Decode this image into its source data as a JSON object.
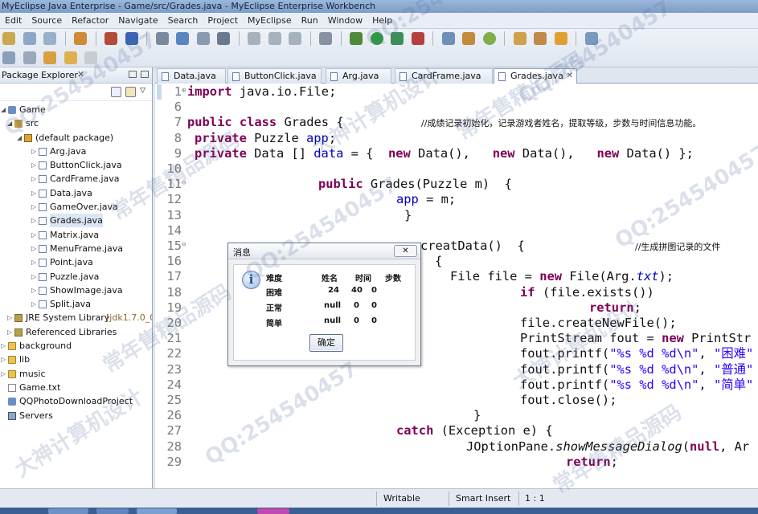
{
  "window": {
    "title": "MyEclipse Java Enterprise - Game/src/Grades.java - MyEclipse Enterprise Workbench"
  },
  "menu": [
    "Edit",
    "Source",
    "Refactor",
    "Navigate",
    "Search",
    "Project",
    "MyEclipse",
    "Run",
    "Window",
    "Help"
  ],
  "package_explorer": {
    "title": "Package Explorer",
    "close": "✕",
    "tree": [
      {
        "label": "Game",
        "icon": "project-icon"
      },
      {
        "label": "src",
        "icon": "source-folder-icon"
      },
      {
        "label": "(default package)",
        "icon": "package-icon"
      },
      {
        "label": "Arg.java",
        "icon": "java-file-icon"
      },
      {
        "label": "ButtonClick.java",
        "icon": "java-file-icon"
      },
      {
        "label": "CardFrame.java",
        "icon": "java-file-icon"
      },
      {
        "label": "Data.java",
        "icon": "java-file-icon"
      },
      {
        "label": "GameOver.java",
        "icon": "java-file-icon"
      },
      {
        "label": "Grades.java",
        "icon": "java-file-icon"
      },
      {
        "label": "Matrix.java",
        "icon": "java-file-icon"
      },
      {
        "label": "MenuFrame.java",
        "icon": "java-file-icon"
      },
      {
        "label": "Point.java",
        "icon": "java-file-icon"
      },
      {
        "label": "Puzzle.java",
        "icon": "java-file-icon"
      },
      {
        "label": "ShowImage.java",
        "icon": "java-file-icon"
      },
      {
        "label": "Split.java",
        "icon": "java-file-icon"
      },
      {
        "label": "JRE System Library",
        "suffix": "[jdk1.7.0_0",
        "icon": "library-icon"
      },
      {
        "label": "Referenced Libraries",
        "icon": "library-icon"
      },
      {
        "label": "background",
        "icon": "folder-icon"
      },
      {
        "label": "lib",
        "icon": "folder-icon"
      },
      {
        "label": "music",
        "icon": "folder-icon"
      },
      {
        "label": "Game.txt",
        "icon": "text-file-icon"
      },
      {
        "label": "QQPhotoDownloadProject",
        "icon": "project-icon"
      },
      {
        "label": "Servers",
        "icon": "server-icon"
      }
    ]
  },
  "editor": {
    "tabs": [
      {
        "label": "Data.java"
      },
      {
        "label": "ButtonClick.java"
      },
      {
        "label": "Arg.java"
      },
      {
        "label": "CardFrame.java"
      },
      {
        "label": "Grades.java",
        "close": "✕"
      }
    ],
    "line_numbers": [
      "1",
      "6",
      "7",
      "8",
      "9",
      "10",
      "11",
      "12",
      "13",
      "14",
      "15",
      "16",
      "17",
      "18",
      "19",
      "20",
      "21",
      "22",
      "23",
      "24",
      "25",
      "26",
      "27",
      "28",
      "29"
    ],
    "code": {
      "l1_kw": "import",
      "l1_rest": " java.io.File;",
      "l7_kw1": "public class",
      "l7_rest": " Grades {",
      "l7_comment": "//成绩记录初始化，记录游戏者姓名，提取等级，步数与时间信息功能。",
      "l8_kw": "private",
      "l8_rest": " Puzzle ",
      "l8_field": "app",
      "l8_end": ";",
      "l9_kw": "private",
      "l9_rest": " Data [] ",
      "l9_field": "data",
      "l9_eq": " = {  ",
      "l9_new1": "new",
      "l9_d1": " Data(),   ",
      "l9_new2": "new",
      "l9_d2": " Data(),   ",
      "l9_new3": "new",
      "l9_d3": " Data() };",
      "l11_kw": "public",
      "l11_rest": " Grades(Puzzle m)  {",
      "l12_field": "app",
      "l12_rest": " = m;",
      "l13": "}",
      "l15_rest": "creatData()  {",
      "l15_comment": "//生成拼图记录的文件",
      "l16": "{",
      "l17_a": "File file = ",
      "l17_new": "new",
      "l17_b": " File(Arg.",
      "l17_it": "txt",
      "l17_c": ");",
      "l18_kw": "if",
      "l18_rest": " (file.exists())",
      "l19_kw": "return",
      "l19_rest": ";",
      "l20": "file.createNewFile();",
      "l21_a": "PrintStream fout = ",
      "l21_new": "new",
      "l21_b": " PrintStr",
      "l22_a": "fout.printf(",
      "l22_s": "\"%s %d %d\\n\"",
      "l22_b": ", ",
      "l22_s2": "\"困难\"",
      "l23_a": "fout.printf(",
      "l23_s": "\"%s %d %d\\n\"",
      "l23_b": ", ",
      "l23_s2": "\"普通\"",
      "l24_a": "fout.printf(",
      "l24_s": "\"%s %d %d\\n\"",
      "l24_b": ", ",
      "l24_s2": "\"简单\"",
      "l25": "fout.close();",
      "l26": "}",
      "l27_kw": "catch",
      "l27_rest": " (Exception e) {",
      "l28_a": "JOptionPane.",
      "l28_it": "showMessageDialog",
      "l28_b": "(",
      "l28_kw": "null",
      "l28_c": ", Ar",
      "l29_kw": "return",
      "l29_rest": ";"
    }
  },
  "dialog": {
    "title": "消息",
    "close": "✕",
    "headers": [
      "难度",
      "姓名",
      "时间",
      "步数"
    ],
    "rows": [
      [
        "困难",
        "24",
        "40",
        "0"
      ],
      [
        "正常",
        "null",
        "0",
        "0"
      ],
      [
        "简单",
        "null",
        "0",
        "0"
      ]
    ],
    "ok_label": "确定"
  },
  "status": {
    "writable": "Writable",
    "insert_mode": "Smart Insert",
    "position": "1 : 1"
  },
  "watermarks": [
    "QQ:254540457",
    "大神计算机设计",
    "常年售精品源码",
    "QQ:254540457",
    "大神计算机设计",
    "常年售精品源码",
    "QQ:254540457",
    "QQ:254540457",
    "常年售精品源码",
    "QQ:254540457",
    "大神计算机设计",
    "常年售精品源码",
    "QQ:254540457"
  ]
}
